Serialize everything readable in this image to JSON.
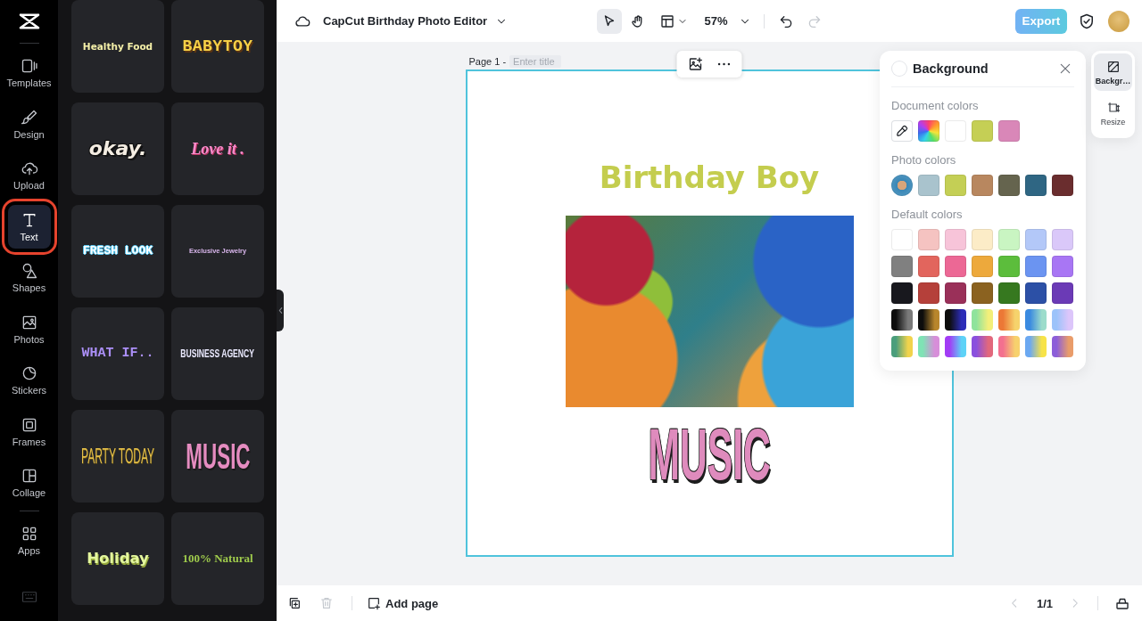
{
  "rail": {
    "items": [
      {
        "label": "Templates",
        "selected": false
      },
      {
        "label": "Design",
        "selected": false
      },
      {
        "label": "Upload",
        "selected": false
      },
      {
        "label": "Text",
        "selected": true
      },
      {
        "label": "Shapes",
        "selected": false
      },
      {
        "label": "Photos",
        "selected": false
      },
      {
        "label": "Stickers",
        "selected": false
      },
      {
        "label": "Frames",
        "selected": false
      },
      {
        "label": "Collage",
        "selected": false
      }
    ],
    "more_items": [
      {
        "label": "Apps",
        "selected": false
      }
    ]
  },
  "text_panel": {
    "rows": [
      {
        "cards": [
          {
            "text": "Healthy Food",
            "kind": "chunky",
            "color": "#f4efa8"
          },
          {
            "text": "BABYTOY",
            "kind": "pixel",
            "color": "#f6d046"
          }
        ]
      },
      {
        "cards": [
          {
            "text": "okay.",
            "kind": "heavy",
            "color": "#f4ede2"
          },
          {
            "text": "Love it .",
            "kind": "script",
            "color": "#f78bcb"
          }
        ]
      },
      {
        "cards": [
          {
            "text": "FRESH LOOK",
            "kind": "outline",
            "color": "#ffffff"
          },
          {
            "text": "Exclusive Jewelry",
            "kind": "small",
            "color": "#d9b6ec"
          }
        ]
      },
      {
        "cards": [
          {
            "text": "WHAT IF..",
            "kind": "mono",
            "color": "#ab8ff7"
          },
          {
            "text": "BUSINESS AGENCY",
            "kind": "condensed",
            "color": "#ebeaff"
          }
        ]
      },
      {
        "cards": [
          {
            "text": "PARTY TODAY",
            "kind": "hollow",
            "color": "#e4bf48"
          },
          {
            "text": "MUSIC",
            "kind": "bubble",
            "color": "#e58cc0"
          }
        ]
      },
      {
        "cards": [
          {
            "text": "Holiday",
            "kind": "raised",
            "color": "#e4f79e"
          },
          {
            "text": "100% Natural",
            "kind": "serif",
            "color": "#9fcb4c"
          }
        ]
      }
    ]
  },
  "header": {
    "title": "CapCut Birthday Photo Editor",
    "tools": [
      {
        "selected": true
      },
      {
        "selected": false
      }
    ],
    "zoom": "57%",
    "undo": {
      "disabled": false
    },
    "redo": {
      "disabled": true
    },
    "export": "Export"
  },
  "canvas": {
    "page_label": "Page 1 -",
    "title_placeholder": "Enter title",
    "elements": [
      {
        "kind": "heading",
        "text": "Birthday Boy",
        "color": "#c4cd4e"
      },
      {
        "kind": "photo"
      },
      {
        "kind": "sticker",
        "text": "MUSIC",
        "color": "#df8bbd"
      }
    ]
  },
  "background_panel": {
    "title": "Background",
    "current": {
      "color": "#ffffff"
    },
    "sections": [
      {
        "title": "Document colors",
        "swatches": [
          {
            "kind": "picker"
          },
          {
            "kind": "spectrum"
          },
          {
            "kind": "solid",
            "color": "#ffffff"
          },
          {
            "kind": "solid",
            "color": "#c5cf55"
          },
          {
            "kind": "solid",
            "color": "#d987b8"
          }
        ]
      },
      {
        "title": "Photo colors",
        "swatches": [
          {
            "kind": "photo"
          },
          {
            "kind": "solid",
            "color": "#a9c3cd"
          },
          {
            "kind": "solid",
            "color": "#c4cf55"
          },
          {
            "kind": "solid",
            "color": "#b8875f"
          },
          {
            "kind": "solid",
            "color": "#65644e"
          },
          {
            "kind": "solid",
            "color": "#2f6683"
          },
          {
            "kind": "solid",
            "color": "#6a2d2e"
          }
        ]
      },
      {
        "title": "Default colors",
        "swatches": [
          {
            "kind": "solid",
            "color": "#ffffff"
          },
          {
            "kind": "solid",
            "color": "#f5c3c1"
          },
          {
            "kind": "solid",
            "color": "#f7c4d9"
          },
          {
            "kind": "solid",
            "color": "#fcecc7"
          },
          {
            "kind": "solid",
            "color": "#c9f5c2"
          },
          {
            "kind": "solid",
            "color": "#b3c8f8"
          },
          {
            "kind": "solid",
            "color": "#dac8f9"
          },
          {
            "kind": "solid",
            "color": "#808080"
          },
          {
            "kind": "solid",
            "color": "#e2655d"
          },
          {
            "kind": "solid",
            "color": "#ec6895"
          },
          {
            "kind": "solid",
            "color": "#eda93c"
          },
          {
            "kind": "solid",
            "color": "#5cbd3c"
          },
          {
            "kind": "solid",
            "color": "#6b94f1"
          },
          {
            "kind": "solid",
            "color": "#a876f4"
          },
          {
            "kind": "solid",
            "color": "#18181e"
          },
          {
            "kind": "solid",
            "color": "#b5403a"
          },
          {
            "kind": "solid",
            "color": "#9a3059"
          },
          {
            "kind": "solid",
            "color": "#8b6220"
          },
          {
            "kind": "solid",
            "color": "#36781f"
          },
          {
            "kind": "solid",
            "color": "#2c50a6"
          },
          {
            "kind": "solid",
            "color": "#6b3ab6"
          },
          {
            "kind": "gradient",
            "stops": [
              {
                "color": "#0d0d0d"
              },
              {
                "color": "#7a7a7a"
              }
            ]
          },
          {
            "kind": "gradient",
            "stops": [
              {
                "color": "#0d0d0d"
              },
              {
                "color": "#b8862c"
              }
            ]
          },
          {
            "kind": "gradient",
            "stops": [
              {
                "color": "#0d0d0d"
              },
              {
                "color": "#2d2db8"
              }
            ]
          },
          {
            "kind": "gradient",
            "stops": [
              {
                "color": "#8fe39c"
              },
              {
                "color": "#f3ef7a"
              }
            ]
          },
          {
            "kind": "gradient",
            "stops": [
              {
                "color": "#ec7836"
              },
              {
                "color": "#f6d36c"
              }
            ]
          },
          {
            "kind": "gradient",
            "stops": [
              {
                "color": "#3a8ae0"
              },
              {
                "color": "#9cdccb"
              }
            ]
          },
          {
            "kind": "gradient",
            "stops": [
              {
                "color": "#9cc3fa"
              },
              {
                "color": "#dcc6fa"
              }
            ]
          },
          {
            "kind": "gradient",
            "stops": [
              {
                "color": "#4a9e7c"
              },
              {
                "color": "#f1d34c"
              }
            ]
          },
          {
            "kind": "gradient",
            "stops": [
              {
                "color": "#7fe3b5"
              },
              {
                "color": "#d78ed9"
              }
            ]
          },
          {
            "kind": "gradient",
            "stops": [
              {
                "color": "#a23cf5"
              },
              {
                "color": "#5dd2f7"
              }
            ]
          },
          {
            "kind": "gradient",
            "stops": [
              {
                "color": "#8a50de"
              },
              {
                "color": "#e2687c"
              }
            ]
          },
          {
            "kind": "gradient",
            "stops": [
              {
                "color": "#f3708f"
              },
              {
                "color": "#f7d16d"
              }
            ]
          },
          {
            "kind": "gradient",
            "stops": [
              {
                "color": "#6ba8f1"
              },
              {
                "color": "#f7e348"
              }
            ]
          },
          {
            "kind": "gradient",
            "stops": [
              {
                "color": "#8c5ed9"
              },
              {
                "color": "#e99c6a"
              }
            ]
          }
        ]
      }
    ]
  },
  "side_tabs": [
    {
      "label": "Backgr…",
      "selected": true
    },
    {
      "label": "Resize",
      "selected": false
    }
  ],
  "footer": {
    "delete": {
      "disabled": true
    },
    "add_page": "Add page",
    "prev": {
      "disabled": true
    },
    "pager": "1/1",
    "next": {
      "disabled": true
    }
  }
}
